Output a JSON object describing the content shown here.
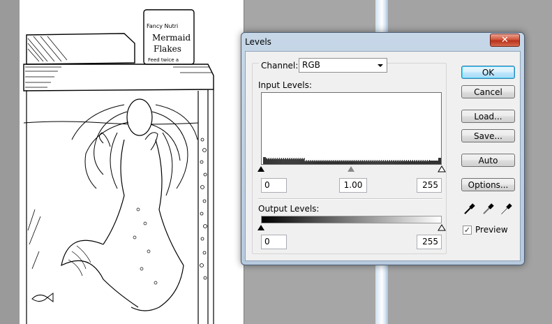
{
  "dialog": {
    "title": "Levels",
    "close_glyph": "✕"
  },
  "channel": {
    "label": "Channel:",
    "selected": "RGB"
  },
  "input_levels": {
    "label": "Input Levels:",
    "black": "0",
    "gamma": "1.00",
    "white": "255"
  },
  "output_levels": {
    "label": "Output Levels:",
    "black": "0",
    "white": "255"
  },
  "buttons": {
    "ok": "OK",
    "cancel": "Cancel",
    "load": "Load...",
    "save": "Save...",
    "auto": "Auto",
    "options": "Options..."
  },
  "eyedroppers": [
    "eyedropper-black-icon",
    "eyedropper-gray-icon",
    "eyedropper-white-icon"
  ],
  "preview": {
    "label": "Preview",
    "checked": true,
    "check_glyph": "✓"
  },
  "artwork": {
    "label_lines": [
      "Mermaid",
      "Flakes"
    ],
    "top_text": "Fancy Nutri",
    "bottom_text": "Feed twice a"
  },
  "colors": {
    "dialog_frame": "#b6c9dd",
    "close_button": "#c7432a",
    "ok_highlight": "#3c7fb1"
  }
}
